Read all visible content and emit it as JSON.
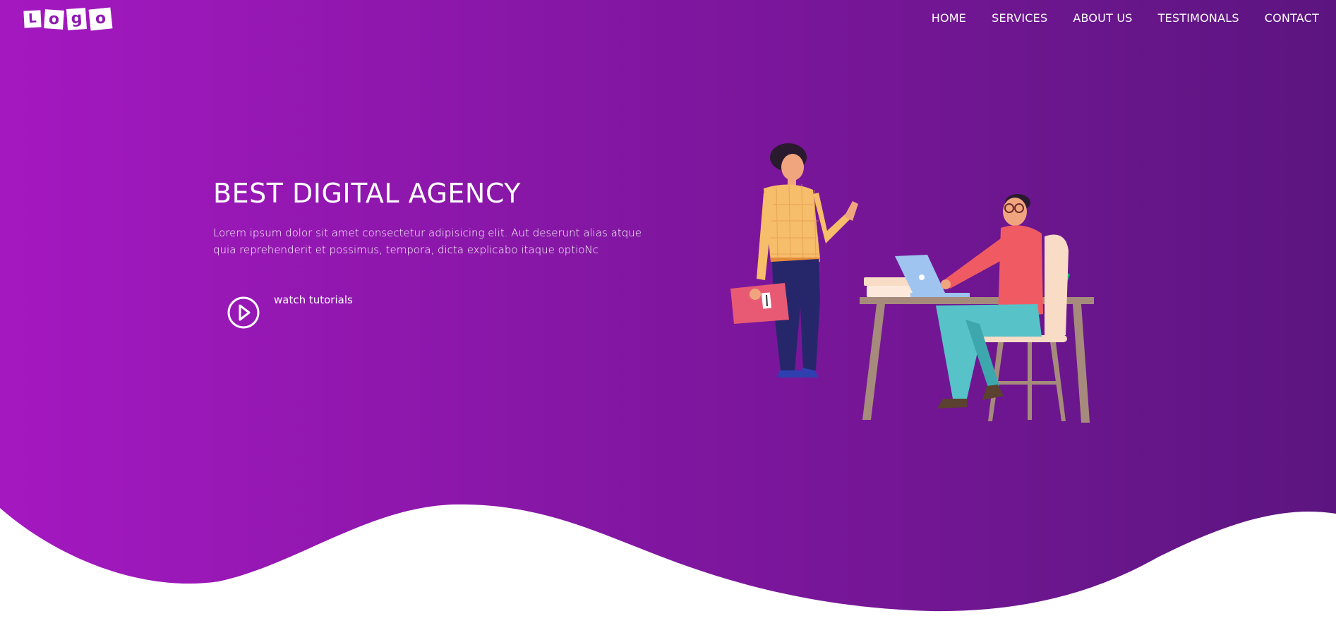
{
  "header": {
    "logo_letters": [
      "L",
      "o",
      "g",
      "o"
    ],
    "nav": [
      "HOME",
      "SERVICES",
      "ABOUT US",
      "TESTIMONALS",
      "CONTACT"
    ]
  },
  "hero": {
    "title": "BEST DIGITAL AGENCY",
    "description": "Lorem ipsum dolor sit amet consectetur adipisicing elit. Aut deserunt alias atque quia reprehenderit et possimus, tempora, dicta explicabo itaque optioNc",
    "cta_label": "watch tutorials",
    "cta_icon": "play-circle-icon",
    "illustration": "people-at-office-desk-illustration"
  },
  "colors": {
    "gradient_start": "#a317bf",
    "gradient_end": "#5e1581",
    "text": "#ffffff"
  }
}
